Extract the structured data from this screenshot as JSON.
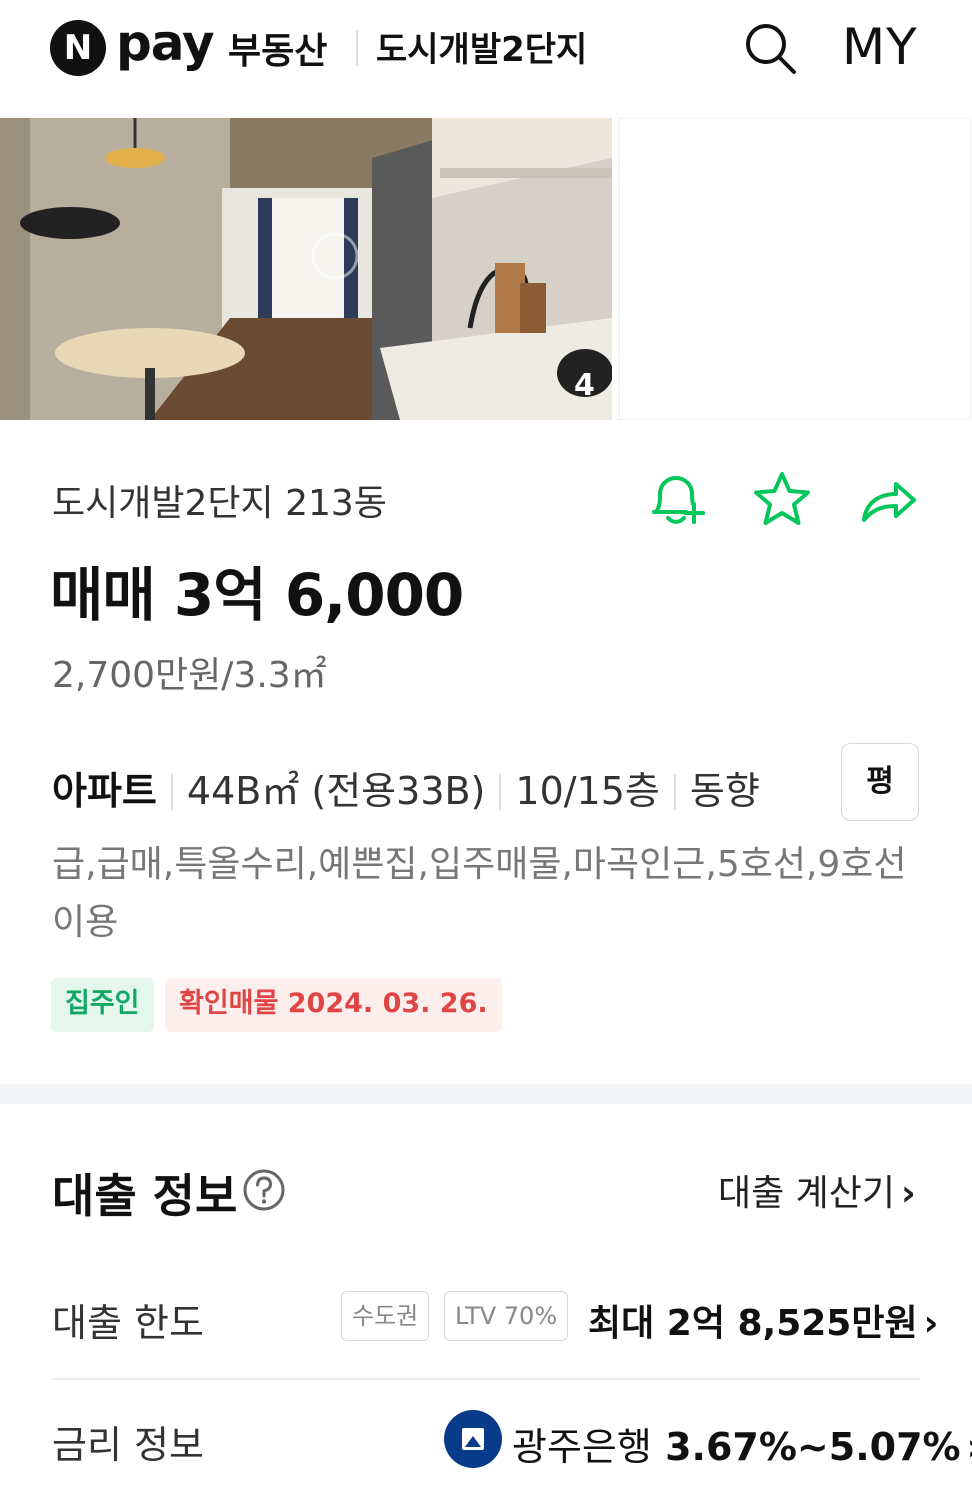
{
  "header": {
    "logo_letter": "N",
    "logo_pay": "pay",
    "logo_service": "부동산",
    "complex_name": "도시개발2단지",
    "my_label": "MY"
  },
  "gallery": {
    "photo_count": "4"
  },
  "listing": {
    "title": "도시개발2단지 213동",
    "price": "매매 3억 6,000",
    "unit_price": "2,700만원/3.3㎡",
    "type": "아파트",
    "area": "44B㎡ (전용33B)",
    "floor": "10/15층",
    "direction": "동향",
    "unit_toggle": "평",
    "features": "급,급매,특올수리,예쁜집,입주매물,마곡인근,5호선,9호선 이용",
    "tag_owner": "집주인",
    "tag_verified": "확인매물 2024. 03. 26."
  },
  "loan": {
    "title": "대출 정보",
    "calculator_label": "대출 계산기",
    "limit_label": "대출 한도",
    "region_badge": "수도권",
    "ltv_badge": "LTV 70%",
    "limit_value": "최대 2억 8,525만원",
    "rate_label": "금리 정보",
    "bank_name": "광주은행",
    "rate_value": "3.67%~5.07%",
    "chevron": "›"
  },
  "colors": {
    "accent_green": "#03c75a",
    "owner_tag": "#10a862",
    "verified_tag": "#e04545",
    "bank_blue": "#0a3a8a"
  },
  "icons": [
    "search-icon",
    "bell-plus-icon",
    "star-icon",
    "share-icon",
    "help-icon",
    "chevron-right-icon",
    "bank-logo-icon"
  ]
}
